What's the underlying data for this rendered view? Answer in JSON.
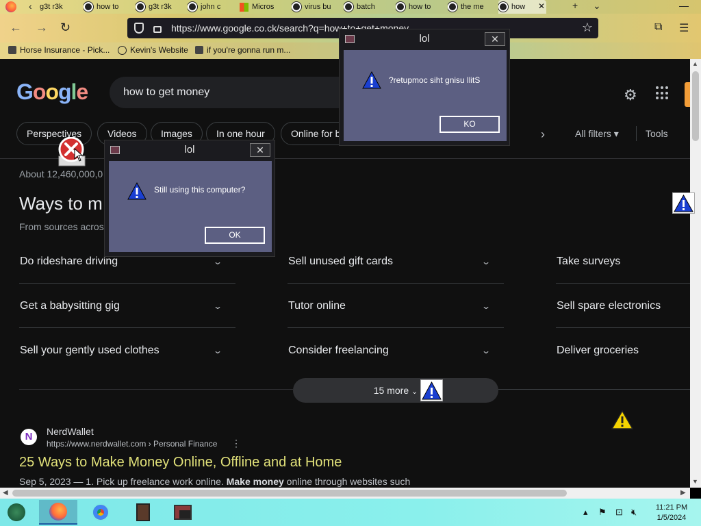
{
  "browser": {
    "tabs": [
      {
        "label": "g3t r3k",
        "icon": "google-icon"
      },
      {
        "label": "how to",
        "icon": "google-icon"
      },
      {
        "label": "g3t r3k",
        "icon": "google-icon"
      },
      {
        "label": "john c",
        "icon": "google-icon"
      },
      {
        "label": "Micros",
        "icon": "microsoft-icon"
      },
      {
        "label": "virus bu",
        "icon": "google-icon"
      },
      {
        "label": "batch",
        "icon": "google-icon"
      },
      {
        "label": "how to",
        "icon": "google-icon"
      },
      {
        "label": "the me",
        "icon": "google-icon"
      },
      {
        "label": "how",
        "icon": "google-icon"
      }
    ],
    "url": "https://www.google.co.ck/search?q=how+to+get+money",
    "bookmarks": [
      "Horse Insurance - Pick...",
      "Kevin's Website",
      "if you're gonna run m..."
    ]
  },
  "google": {
    "logo": [
      "G",
      "o",
      "o",
      "g",
      "l",
      "e"
    ],
    "query": "how to get money",
    "chips": [
      "Perspectives",
      "Videos",
      "Images",
      "In one hour",
      "Online for b"
    ],
    "all_filters": "All filters",
    "tools": "Tools",
    "stats": "About 12,460,000,0",
    "heading": "Ways to m",
    "subheading": "From sources acros",
    "faq": [
      [
        "Do rideshare driving",
        "Sell unused gift cards",
        "Take surveys"
      ],
      [
        "Get a babysitting gig",
        "Tutor online",
        "Sell spare electronics"
      ],
      [
        "Sell your gently used clothes",
        "Consider freelancing",
        "Deliver groceries"
      ]
    ],
    "more": "15 more",
    "result": {
      "site": "NerdWallet",
      "url": "https://www.nerdwallet.com › Personal Finance",
      "title": "25 Ways to Make Money Online, Offline and at Home",
      "date": "Sep 5, 2023 — 1. Pick up freelance work online.",
      "bold": "Make money",
      "rest": "online through websites such"
    }
  },
  "dialogs": [
    {
      "title": "lol",
      "message": "?retupmoc siht gnisu llitS",
      "button": "KO"
    },
    {
      "title": "lol",
      "message": "Still using this computer?",
      "button": "OK"
    }
  ],
  "taskbar": {
    "time": "11:21 PM",
    "date": "1/5/2024"
  },
  "colors": {
    "dialog_body": "#5c5f82",
    "result_title": "#e2e27a",
    "taskbar": "#7ee8e8"
  }
}
